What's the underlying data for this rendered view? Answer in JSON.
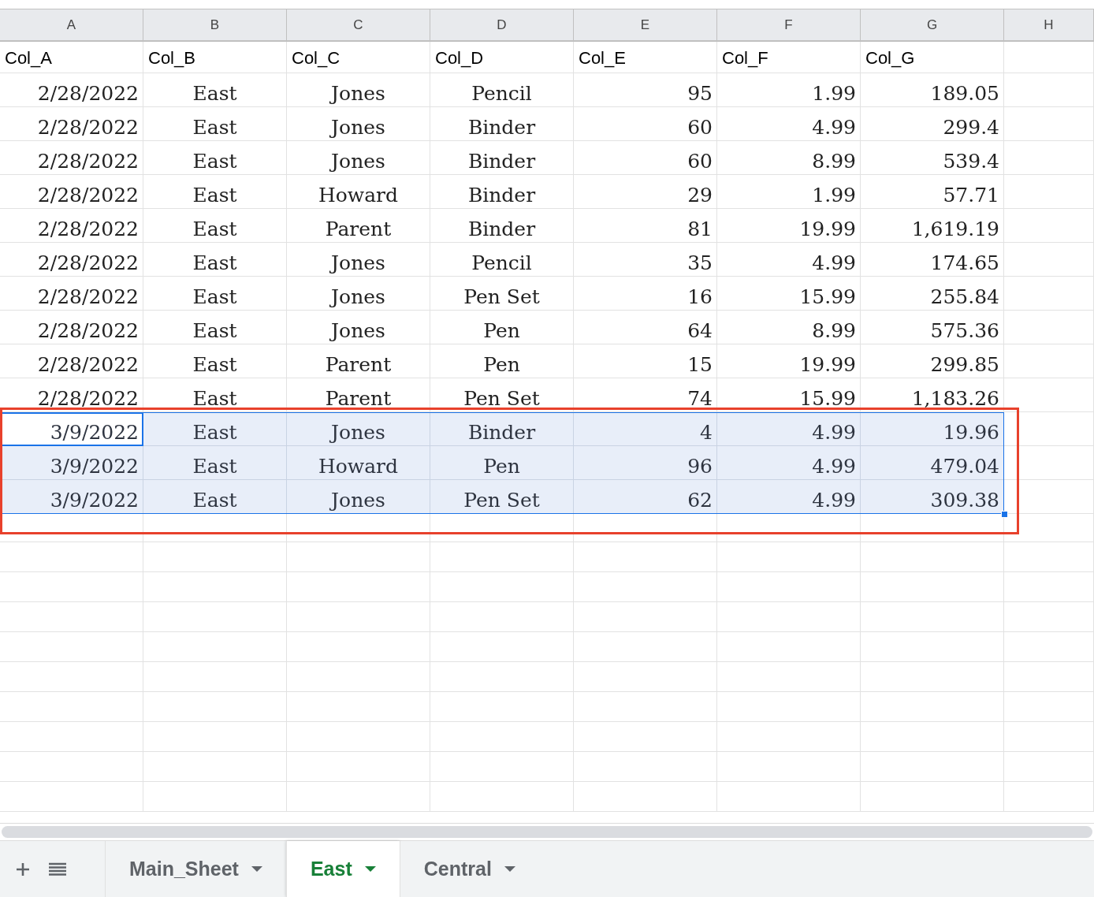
{
  "columns": [
    "A",
    "B",
    "C",
    "D",
    "E",
    "F",
    "G",
    "H"
  ],
  "header_row": [
    "Col_A",
    "Col_B",
    "Col_C",
    "Col_D",
    "Col_E",
    "Col_F",
    "Col_G"
  ],
  "rows": [
    {
      "cells": [
        "2/28/2022",
        "East",
        "Jones",
        "Pencil",
        "95",
        "1.99",
        "189.05"
      ],
      "selected": false,
      "active": false
    },
    {
      "cells": [
        "2/28/2022",
        "East",
        "Jones",
        "Binder",
        "60",
        "4.99",
        "299.4"
      ],
      "selected": false,
      "active": false
    },
    {
      "cells": [
        "2/28/2022",
        "East",
        "Jones",
        "Binder",
        "60",
        "8.99",
        "539.4"
      ],
      "selected": false,
      "active": false
    },
    {
      "cells": [
        "2/28/2022",
        "East",
        "Howard",
        "Binder",
        "29",
        "1.99",
        "57.71"
      ],
      "selected": false,
      "active": false
    },
    {
      "cells": [
        "2/28/2022",
        "East",
        "Parent",
        "Binder",
        "81",
        "19.99",
        "1,619.19"
      ],
      "selected": false,
      "active": false
    },
    {
      "cells": [
        "2/28/2022",
        "East",
        "Jones",
        "Pencil",
        "35",
        "4.99",
        "174.65"
      ],
      "selected": false,
      "active": false
    },
    {
      "cells": [
        "2/28/2022",
        "East",
        "Jones",
        "Pen Set",
        "16",
        "15.99",
        "255.84"
      ],
      "selected": false,
      "active": false
    },
    {
      "cells": [
        "2/28/2022",
        "East",
        "Jones",
        "Pen",
        "64",
        "8.99",
        "575.36"
      ],
      "selected": false,
      "active": false
    },
    {
      "cells": [
        "2/28/2022",
        "East",
        "Parent",
        "Pen",
        "15",
        "19.99",
        "299.85"
      ],
      "selected": false,
      "active": false
    },
    {
      "cells": [
        "2/28/2022",
        "East",
        "Parent",
        "Pen Set",
        "74",
        "15.99",
        "1,183.26"
      ],
      "selected": false,
      "active": false
    },
    {
      "cells": [
        "3/9/2022",
        "East",
        "Jones",
        "Binder",
        "4",
        "4.99",
        "19.96"
      ],
      "selected": true,
      "active": true
    },
    {
      "cells": [
        "3/9/2022",
        "East",
        "Howard",
        "Pen",
        "96",
        "4.99",
        "479.04"
      ],
      "selected": true,
      "active": false
    },
    {
      "cells": [
        "3/9/2022",
        "East",
        "Jones",
        "Pen Set",
        "62",
        "4.99",
        "309.38"
      ],
      "selected": true,
      "active": false
    }
  ],
  "highlight_frame": true,
  "sheet_tabs": [
    {
      "label": "Main_Sheet",
      "selected": false
    },
    {
      "label": "East",
      "selected": true
    },
    {
      "label": "Central",
      "selected": false
    }
  ]
}
